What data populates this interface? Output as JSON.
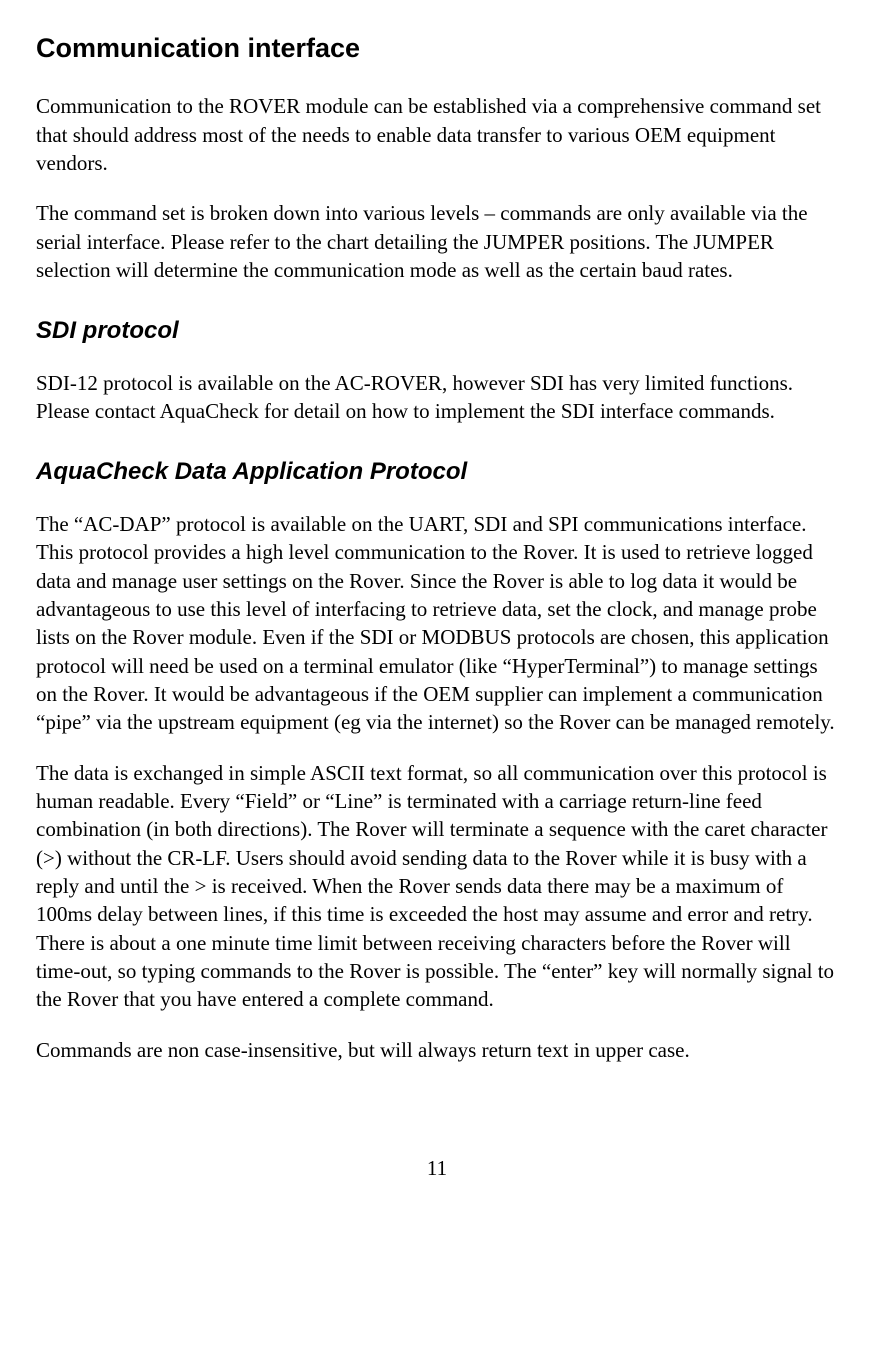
{
  "heading1": "Communication interface",
  "para1": "Communication to the ROVER module can be established via a comprehensive command set that should address most of the needs to enable data transfer to various OEM equipment vendors.",
  "para2": "The command set is broken down into various levels – commands are only available via the serial interface. Please refer to the chart detailing the JUMPER positions. The JUMPER selection will determine the communication mode as well as the certain baud rates.",
  "heading2": "SDI protocol",
  "para3": "SDI-12 protocol is available on the AC-ROVER, however SDI has very limited functions. Please contact AquaCheck for detail on how to implement the SDI interface commands.",
  "heading3": "AquaCheck Data Application Protocol",
  "para4": "The “AC-DAP” protocol is available on the UART, SDI and SPI communications interface. This protocol provides a high level communication to the Rover. It is used to retrieve logged data and manage user settings on the Rover. Since the Rover is able to log data it would be advantageous to use this level of interfacing to retrieve data, set the clock, and manage probe lists on the Rover module. Even if the SDI or MODBUS protocols are chosen, this application protocol will need be used on a terminal emulator (like “HyperTerminal”) to manage settings on the Rover. It would be advantageous if the OEM supplier can implement a communication “pipe” via the upstream equipment (eg via the internet) so the Rover can be managed remotely.",
  "para5": "The data is exchanged in simple ASCII text format, so all communication over this protocol is human readable. Every “Field” or “Line” is terminated with a carriage return-line feed combination (in both directions). The Rover will terminate a sequence with the caret character (>) without the CR-LF. Users should avoid sending data to the Rover while it is busy with a reply and until the > is received. When the Rover sends data there may be a maximum of 100ms delay between lines, if this time is exceeded the host may assume and error and retry. There is about a one minute time limit between receiving characters before the Rover will time-out, so typing commands to the Rover is possible. The “enter” key will normally signal to the Rover that you have entered a complete command.",
  "para6": "Commands are non case-insensitive, but will always return text in upper case.",
  "pageNumber": "11"
}
